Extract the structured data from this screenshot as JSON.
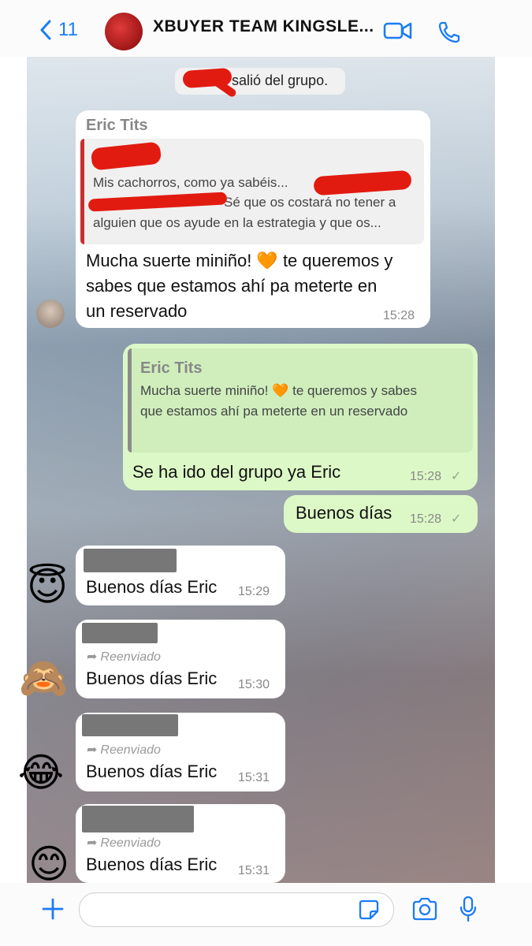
{
  "header": {
    "back_count": "11",
    "title": "XBUYER TEAM KINGSLE...",
    "icons": [
      "chevron-left-icon",
      "video-camera-icon",
      "phone-icon"
    ]
  },
  "messages": {
    "system": {
      "text": "salió del grupo."
    },
    "m1": {
      "sender": "Eric Tits",
      "quote_line1": "Mis cachorros, como ya sabéis...",
      "quote_line2": "Sé que os costará no tener a",
      "quote_line3": "alguien que os ayude en la estrategia y que os...",
      "text_l1": "Mucha suerte miniño! 🧡 te queremos y",
      "text_l2": "sabes que estamos ahí pa meterte en",
      "text_l3": "un reservado",
      "time": "15:28"
    },
    "m2": {
      "quote_sender": "Eric Tits",
      "quote_l1": "Mucha suerte miniño! 🧡 te queremos y sabes",
      "quote_l2": "que estamos ahí pa meterte en un reservado",
      "text": "Se ha ido del grupo ya Eric",
      "time": "15:28",
      "status": "✓"
    },
    "m3": {
      "text": "Buenos días",
      "time": "15:28",
      "status": "✓"
    },
    "m4": {
      "text": "Buenos días Eric",
      "time": "15:29",
      "avatar": "😇"
    },
    "m5": {
      "forwarded": "Reenviado",
      "text": "Buenos días Eric",
      "time": "15:30",
      "avatar": "🙈"
    },
    "m6": {
      "forwarded": "Reenviado",
      "text": "Buenos días Eric",
      "time": "15:31",
      "avatar": "😂"
    },
    "m7": {
      "forwarded": "Reenviado",
      "text": "Buenos días Eric",
      "time": "15:31",
      "avatar": "😊"
    }
  },
  "footer": {
    "icons": [
      "plus-icon",
      "sticker-icon",
      "camera-icon",
      "microphone-icon"
    ],
    "input_placeholder": ""
  },
  "colors": {
    "accent": "#1a7cf6",
    "outgoing": "#dcf8c6",
    "incoming": "#ffffff",
    "redaction": "#e21b10"
  }
}
